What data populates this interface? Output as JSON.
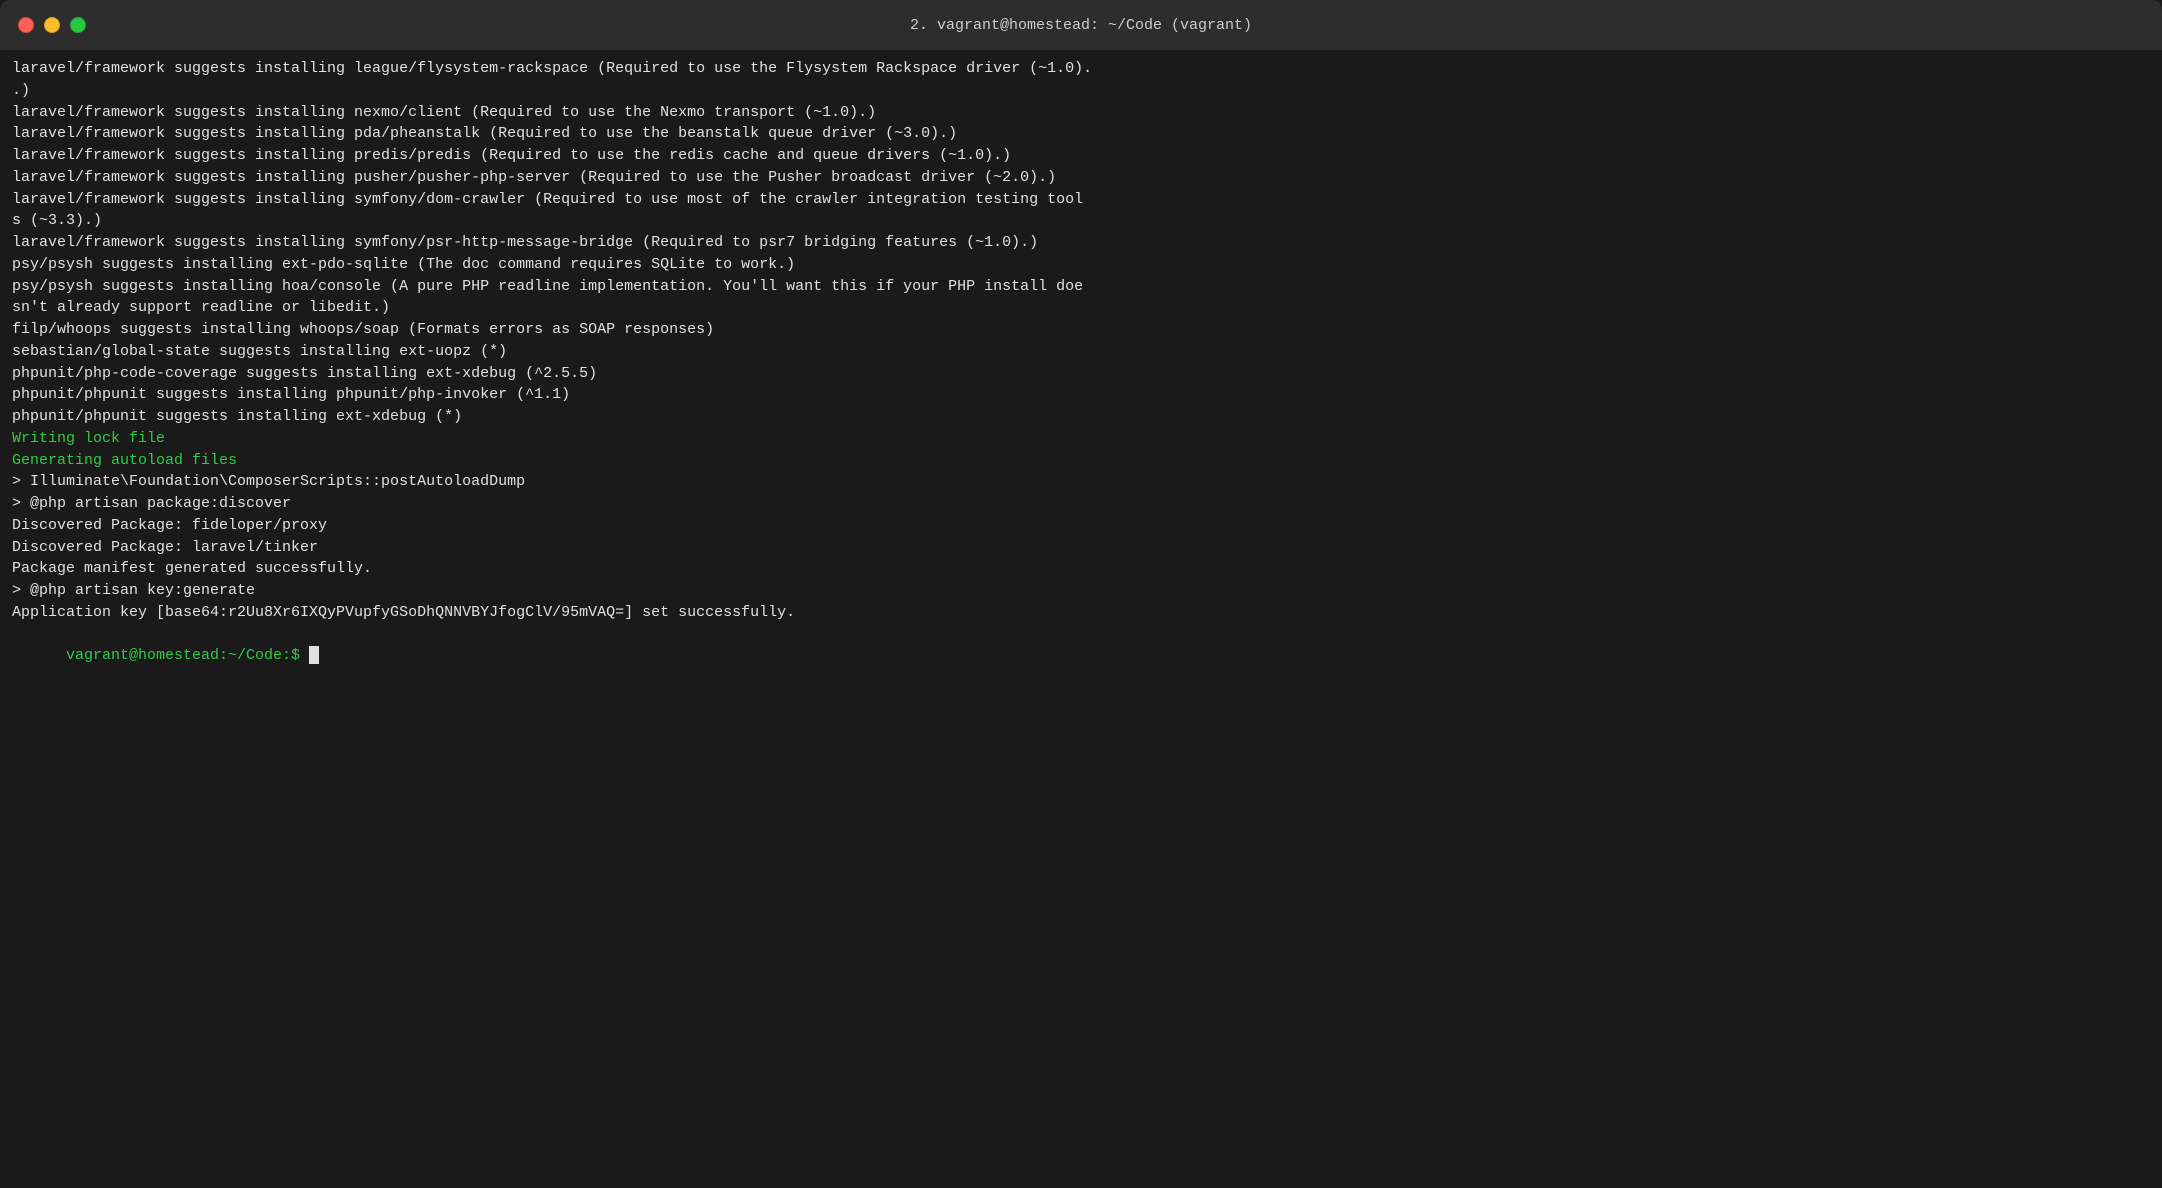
{
  "window": {
    "title": "2. vagrant@homestead: ~/Code (vagrant)"
  },
  "terminal": {
    "lines": [
      {
        "text": "laravel/framework suggests installing league/flysystem-rackspace (Required to use the Flysystem Rackspace driver (~1.0).",
        "type": "normal"
      },
      {
        "text": ".)",
        "type": "normal"
      },
      {
        "text": "laravel/framework suggests installing nexmo/client (Required to use the Nexmo transport (~1.0).)",
        "type": "normal"
      },
      {
        "text": "laravel/framework suggests installing pda/pheanstalk (Required to use the beanstalk queue driver (~3.0).)",
        "type": "normal"
      },
      {
        "text": "laravel/framework suggests installing predis/predis (Required to use the redis cache and queue drivers (~1.0).)",
        "type": "normal"
      },
      {
        "text": "laravel/framework suggests installing pusher/pusher-php-server (Required to use the Pusher broadcast driver (~2.0).)",
        "type": "normal"
      },
      {
        "text": "laravel/framework suggests installing symfony/dom-crawler (Required to use most of the crawler integration testing tool",
        "type": "normal"
      },
      {
        "text": "s (~3.3).)",
        "type": "normal"
      },
      {
        "text": "laravel/framework suggests installing symfony/psr-http-message-bridge (Required to psr7 bridging features (~1.0).)",
        "type": "normal"
      },
      {
        "text": "psy/psysh suggests installing ext-pdo-sqlite (The doc command requires SQLite to work.)",
        "type": "normal"
      },
      {
        "text": "psy/psysh suggests installing hoa/console (A pure PHP readline implementation. You'll want this if your PHP install doe",
        "type": "normal"
      },
      {
        "text": "sn't already support readline or libedit.)",
        "type": "normal"
      },
      {
        "text": "filp/whoops suggests installing whoops/soap (Formats errors as SOAP responses)",
        "type": "normal"
      },
      {
        "text": "sebastian/global-state suggests installing ext-uopz (*)",
        "type": "normal"
      },
      {
        "text": "phpunit/php-code-coverage suggests installing ext-xdebug (^2.5.5)",
        "type": "normal"
      },
      {
        "text": "phpunit/phpunit suggests installing phpunit/php-invoker (^1.1)",
        "type": "normal"
      },
      {
        "text": "phpunit/phpunit suggests installing ext-xdebug (*)",
        "type": "normal"
      },
      {
        "text": "Writing lock file",
        "type": "green"
      },
      {
        "text": "Generating autoload files",
        "type": "green"
      },
      {
        "text": "> Illuminate\\Foundation\\ComposerScripts::postAutoloadDump",
        "type": "normal"
      },
      {
        "text": "> @php artisan package:discover",
        "type": "normal"
      },
      {
        "text": "Discovered Package: fideloper/proxy",
        "type": "normal"
      },
      {
        "text": "Discovered Package: laravel/tinker",
        "type": "normal"
      },
      {
        "text": "Package manifest generated successfully.",
        "type": "normal"
      },
      {
        "text": "> @php artisan key:generate",
        "type": "normal"
      },
      {
        "text": "Application key [base64:r2Uu8Xr6IXQyPVupfyGSoDhQNNVBYJfogClV/95mVAQ=] set successfully.",
        "type": "normal"
      }
    ],
    "prompt": "vagrant@homestead:~/Code",
    "prompt_symbol": "$"
  }
}
